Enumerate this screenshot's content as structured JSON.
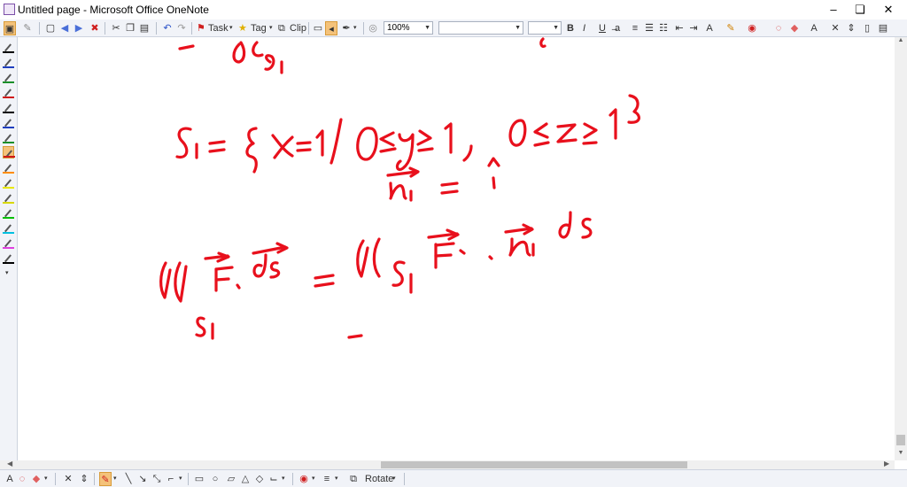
{
  "window": {
    "title": "Untitled page - Microsoft Office OneNote",
    "minimize": "–",
    "maximize": "❏",
    "close": "✕"
  },
  "toolbar": {
    "task_label": "Task",
    "tag_label": "Tag",
    "clip_label": "Clip",
    "zoom_value": "100%",
    "font_value": "",
    "size_value": "",
    "bold": "B",
    "italic": "I",
    "underline": "U",
    "strike": "̶a"
  },
  "drawbar": {
    "rotate_label": "Rotate"
  },
  "colors": {
    "ink": "#e8101c",
    "pens": [
      "#000000",
      "#1f3fbf",
      "#1a8f2a",
      "#d01818",
      "#000000",
      "#1f3fbf",
      "#1a8f2a",
      "#d01818",
      "#ff8c00",
      "#e8e800",
      "#d8d800",
      "#00c000",
      "#00c0e0",
      "#e040e0",
      "#000000"
    ]
  }
}
